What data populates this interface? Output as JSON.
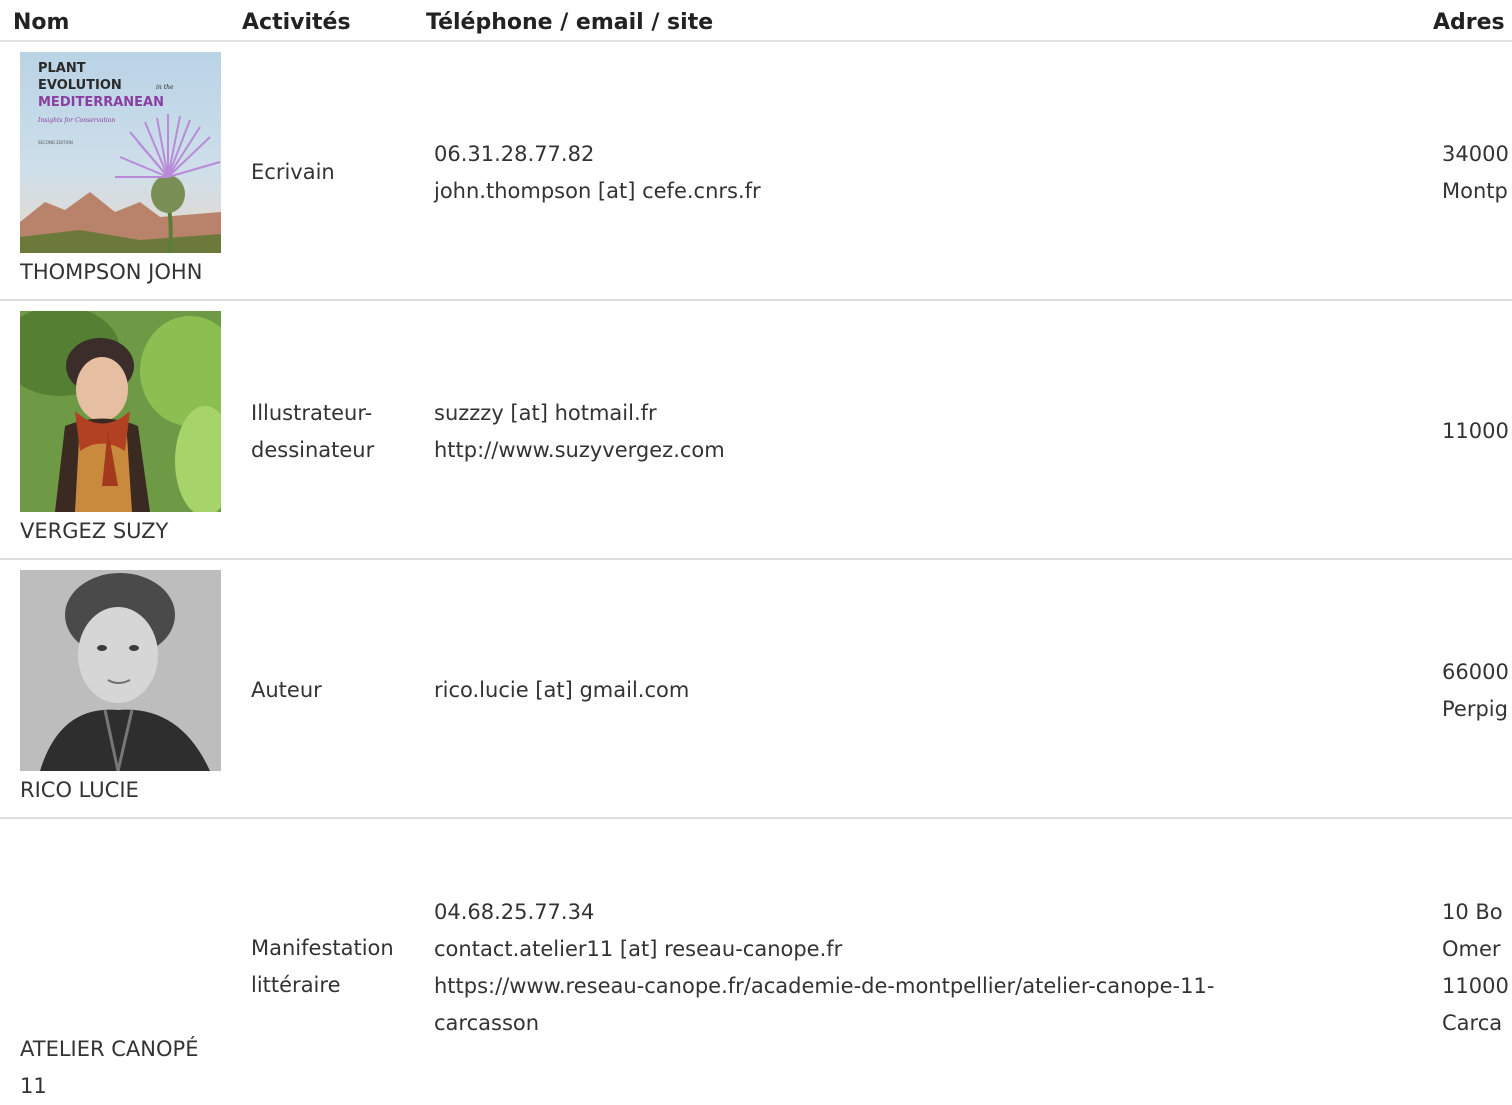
{
  "columns": {
    "nom": "Nom",
    "activites": "Activités",
    "contact": "Téléphone / email / site",
    "adresse": "Adres"
  },
  "rows": [
    {
      "name": "THOMPSON JOHN",
      "photo": "book-cover-plant-evolution",
      "photo_text": {
        "line1": "PLANT",
        "line2": "EVOLUTION",
        "line2_small": "in the",
        "line3": "MEDITERRANEAN",
        "line4": "Insights for Conservation",
        "line5": "SECOND EDITION"
      },
      "activity_lines": [
        "Ecrivain"
      ],
      "contact_lines": [
        "06.31.28.77.82",
        "john.thompson [at] cefe.cnrs.fr"
      ],
      "address_lines": [
        "34000",
        "Montp"
      ]
    },
    {
      "name": "VERGEZ SUZY",
      "photo": "portrait-woman-red-scarf",
      "activity_lines": [
        "Illustrateur-",
        "dessinateur"
      ],
      "contact_lines": [
        "suzzzy [at] hotmail.fr",
        "http://www.suzyvergez.com"
      ],
      "address_lines": [
        "11000"
      ]
    },
    {
      "name": "RICO LUCIE",
      "photo": "portrait-woman-black-white",
      "activity_lines": [
        "Auteur"
      ],
      "contact_lines": [
        "rico.lucie [at] gmail.com"
      ],
      "address_lines": [
        "66000",
        "Perpig"
      ]
    },
    {
      "name_lines": [
        "ATELIER CANOPÉ",
        "11"
      ],
      "activity_lines": [
        "Manifestation",
        "littéraire"
      ],
      "contact_lines": [
        "04.68.25.77.34",
        "contact.atelier11 [at] reseau-canope.fr",
        "https://www.reseau-canope.fr/academie-de-montpellier/atelier-canope-11-",
        "carcasson"
      ],
      "address_lines": [
        "10 Bo",
        "Omer",
        "11000",
        "Carca"
      ]
    }
  ]
}
